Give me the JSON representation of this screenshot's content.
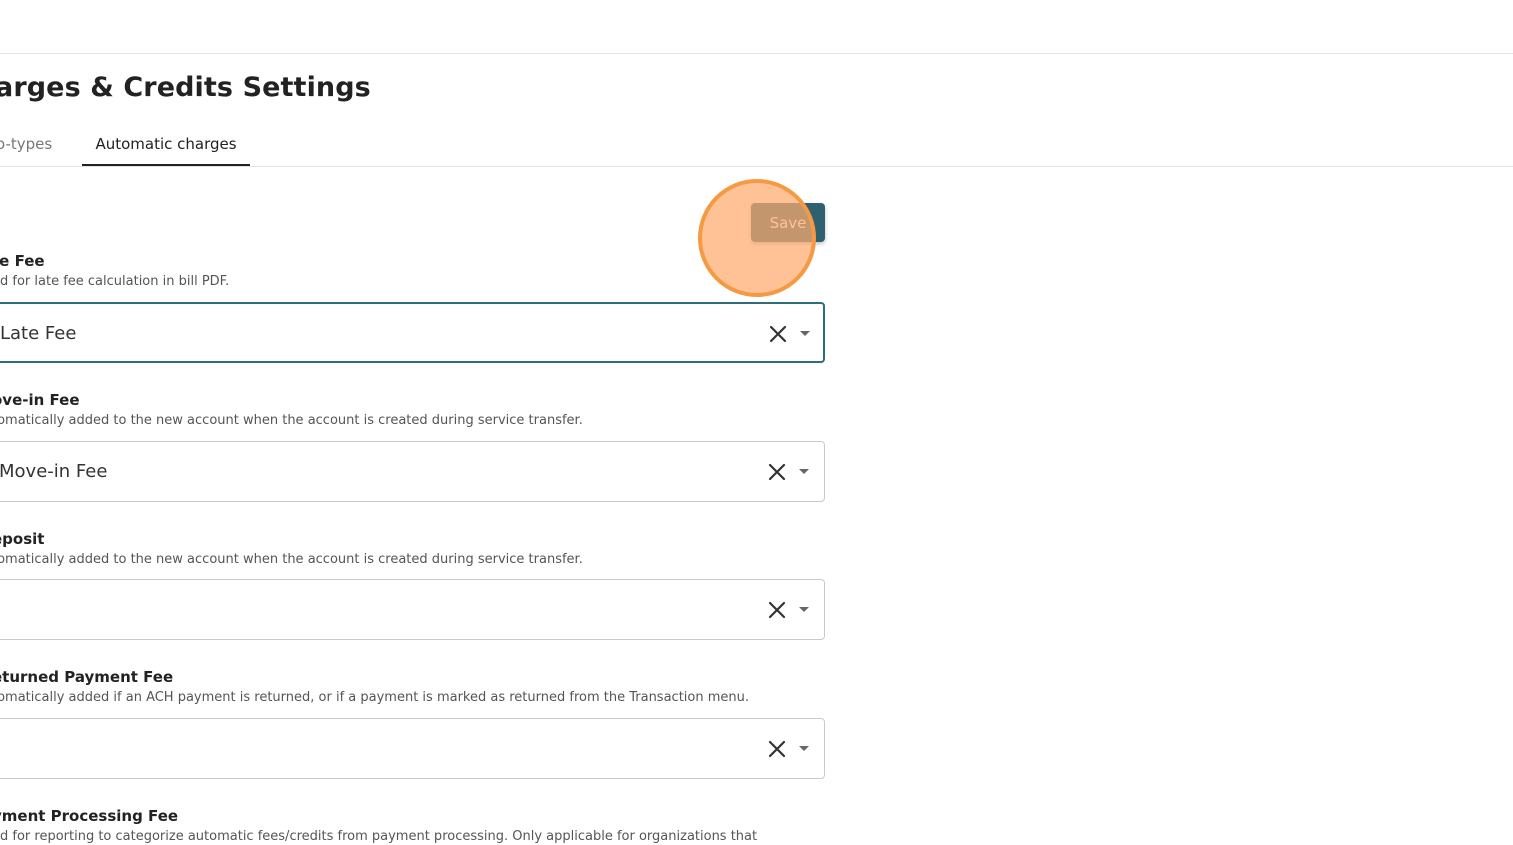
{
  "header": {
    "title": "arges & Credits Settings"
  },
  "tabs": [
    {
      "label": "o-types"
    },
    {
      "label": "Automatic charges"
    }
  ],
  "toolbar": {
    "save_label": "Save"
  },
  "fields": [
    {
      "label": "te Fee",
      "description": "ed for late fee calculation in bill PDF.",
      "value": "Late Fee"
    },
    {
      "label": "ove-in Fee",
      "description": "tomatically added to the new account when the account is created during service transfer.",
      "value": "Move-in Fee"
    },
    {
      "label": "eposit",
      "description": "tomatically added to the new account when the account is created during service transfer.",
      "value": ""
    },
    {
      "label": "eturned Payment Fee",
      "description": "tomatically added if an ACH payment is returned, or if a payment is marked as returned from the Transaction menu.",
      "value": ""
    },
    {
      "label": "yment Processing Fee",
      "description": "ed for reporting to categorize automatic fees/credits from payment processing. Only applicable for organizations that"
    }
  ],
  "colors": {
    "accent": "#2e6070",
    "focus_border": "#2e6e7a",
    "click_indicator": "#f59a43"
  }
}
